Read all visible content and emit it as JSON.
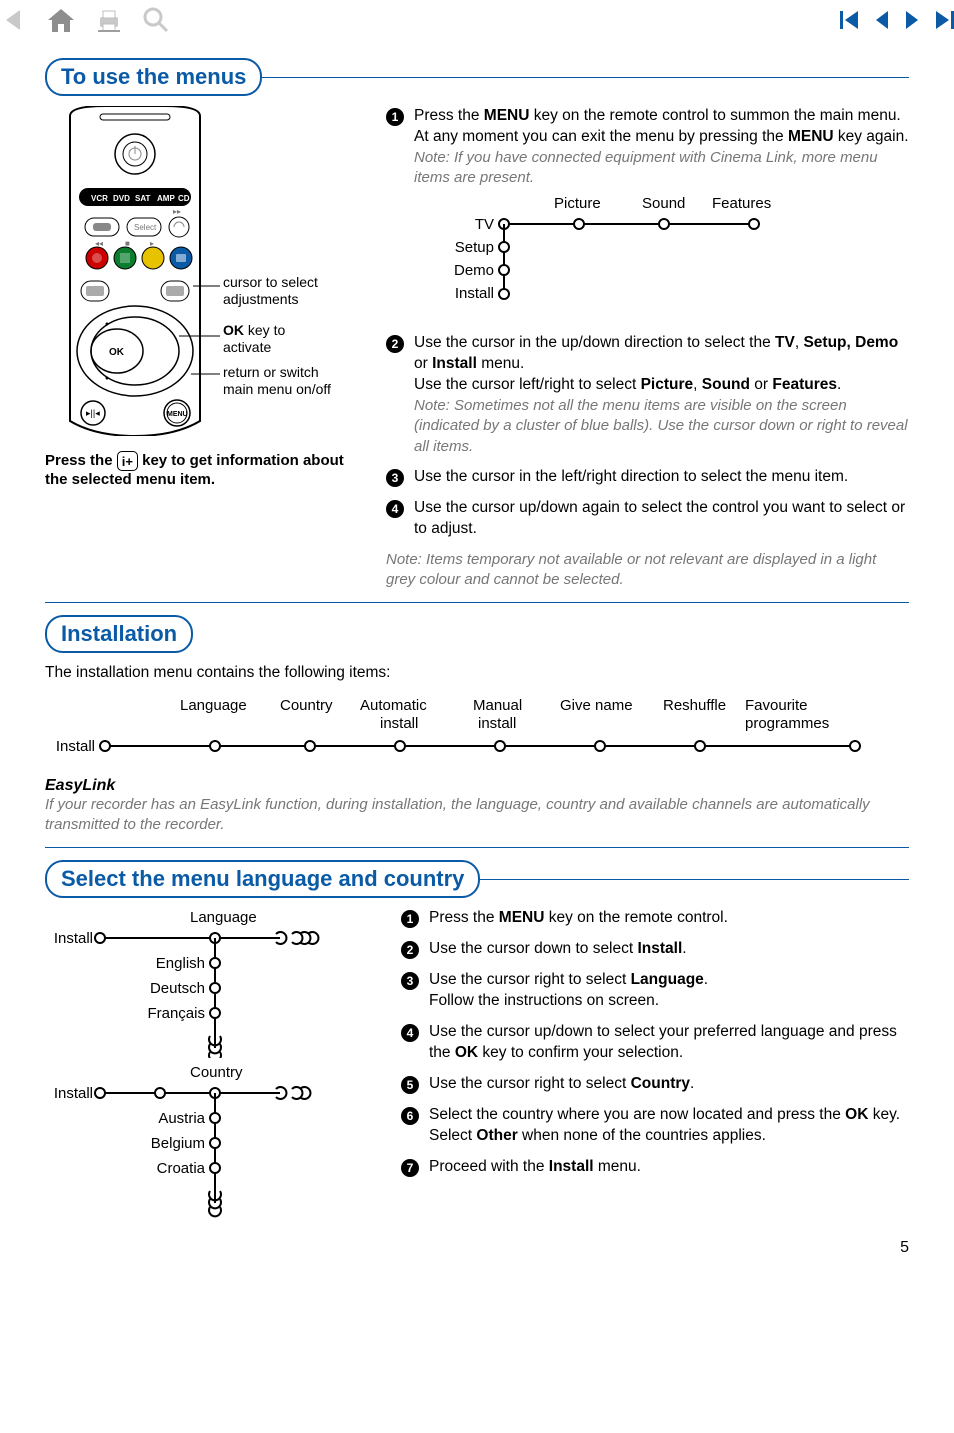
{
  "toolbar": {
    "icons": [
      "back-icon",
      "home-icon",
      "print-icon",
      "search-icon",
      "first-icon",
      "prev-icon",
      "next-icon",
      "last-icon"
    ]
  },
  "headings": {
    "use_menus": "To use the menus",
    "installation": "Installation",
    "select_lang": "Select the menu language and country"
  },
  "remote": {
    "cursor_label_l1": "cursor to select",
    "cursor_label_l2": "adjustments",
    "ok_bold": "OK",
    "ok_rest": " key to",
    "ok_l2": "activate",
    "return_l1": "return or switch",
    "return_l2": "main menu on/off",
    "mode_labels": [
      "VCR",
      "DVD",
      "SAT",
      "AMP",
      "CD"
    ],
    "ok_text": "OK",
    "menu_text": "MENU",
    "select_text": "Select",
    "caption_before": "Press the ",
    "caption_key": "i+",
    "caption_after": " key to get information about the selected menu item."
  },
  "menus_steps": {
    "s1_a": "Press the ",
    "s1_b": "MENU",
    "s1_c": " key on the remote control to summon the main menu. At any moment you can exit the menu by pressing the ",
    "s1_d": "MENU",
    "s1_e": " key again.",
    "s1_note": "Note: If you have connected equipment with Cinema Link, more menu items are present.",
    "s2_a": "Use the cursor in the up/down direction to select the ",
    "s2_tv": "TV",
    "s2_b": ", ",
    "s2_setup": "Setup, Demo",
    "s2_c": " or ",
    "s2_install": "Install",
    "s2_d": " menu.",
    "s2_e": "Use the cursor left/right to select ",
    "s2_pic": "Picture",
    "s2_f": ", ",
    "s2_sound": "Sound",
    "s2_g": " or ",
    "s2_feat": "Features",
    "s2_h": ".",
    "s2_note": "Note: Sometimes not all the menu items are visible on the screen (indicated by a cluster of blue balls). Use the cursor down or right to reveal all items.",
    "s3": "Use the cursor in the left/right direction to select the menu item.",
    "s4": "Use the cursor up/down again to select the control you want to select or to adjust.",
    "end_note": "Note: Items temporary not available or not relevant are displayed in a light grey colour and cannot be selected."
  },
  "chart_data": {
    "type": "tree",
    "root": "TV",
    "columns": [
      "Picture",
      "Sound",
      "Features"
    ],
    "rows": [
      "TV",
      "Setup",
      "Demo",
      "Install"
    ]
  },
  "installation": {
    "intro": "The installation menu contains the following items:",
    "root": "Install",
    "items": [
      "Language",
      "Country",
      "Automatic install",
      "Manual install",
      "Give name",
      "Reshuffle",
      "Favourite programmes"
    ]
  },
  "easylink": {
    "heading": "EasyLink",
    "text": "If your recorder has an EasyLink function, during installation, the language, country and available channels are automatically transmitted to the recorder."
  },
  "select_lang": {
    "lang_diag": {
      "root": "Install",
      "title": "Language",
      "items": [
        "English",
        "Deutsch",
        "Français"
      ]
    },
    "country_diag": {
      "root": "Install",
      "title": "Country",
      "items": [
        "Austria",
        "Belgium",
        "Croatia"
      ]
    },
    "steps": {
      "s1_a": "Press the ",
      "s1_b": "MENU",
      "s1_c": " key on the remote control.",
      "s2_a": "Use the cursor down to select ",
      "s2_b": "Install",
      "s2_c": ".",
      "s3_a": "Use the cursor right to select ",
      "s3_b": "Language",
      "s3_c": ".",
      "s3_d": "Follow the instructions on screen.",
      "s4_a": "Use the cursor up/down to select your preferred language and press the ",
      "s4_b": "OK",
      "s4_c": " key to confirm your selection.",
      "s5_a": "Use the cursor right to select ",
      "s5_b": "Country",
      "s5_c": ".",
      "s6_a": "Select the country where you are now located and press the ",
      "s6_b": "OK",
      "s6_c": " key.",
      "s6_d": "Select ",
      "s6_e": "Other",
      "s6_f": " when none of the countries applies.",
      "s7_a": "Proceed with the ",
      "s7_b": "Install",
      "s7_c": " menu."
    }
  },
  "page_number": "5"
}
